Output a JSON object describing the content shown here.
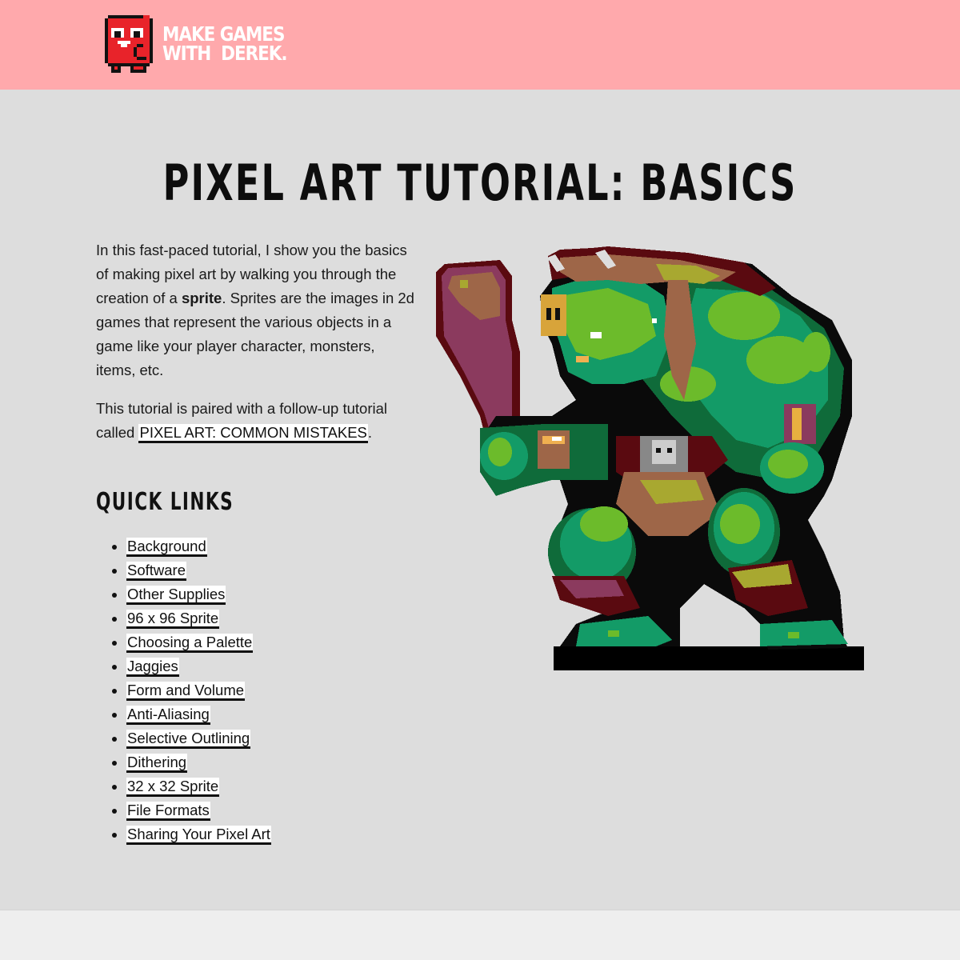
{
  "header": {
    "logo_line1": "MAKE GAMES",
    "logo_line2": "WITH  DEREK.",
    "logo_icon": "red-block-mascot",
    "background_color": "#ffa9ac"
  },
  "page": {
    "title": "PIXEL ART TUTORIAL: BASICS",
    "intro_p1_before": "In this fast-paced tutorial, I show you the basics of making pixel art by walking you through the creation of a ",
    "intro_p1_bold": "sprite",
    "intro_p1_after": ". Sprites are the images in 2d games that represent the various objects in a game like your player character, monsters, items, etc.",
    "intro_p2_before": "This tutorial is paired with a follow-up tutorial called ",
    "intro_p2_link": "PIXEL ART: COMMON MISTAKES",
    "intro_p2_after": ".",
    "quick_links_title": "QUICK LINKS",
    "quick_links": [
      "Background",
      "Software",
      "Other Supplies",
      "96 x 96 Sprite",
      "Choosing a Palette",
      "Jaggies",
      "Form and Volume",
      "Anti-Aliasing",
      "Selective Outlining",
      "Dithering",
      "32 x 32 Sprite",
      "File Formats",
      "Sharing Your Pixel Art"
    ],
    "hero_image": "pixel-art-troll-with-club"
  },
  "colors": {
    "main_bg": "#dddddd",
    "footer_bg": "#eeeeee",
    "link_bg": "#ffffff",
    "text": "#111111"
  }
}
